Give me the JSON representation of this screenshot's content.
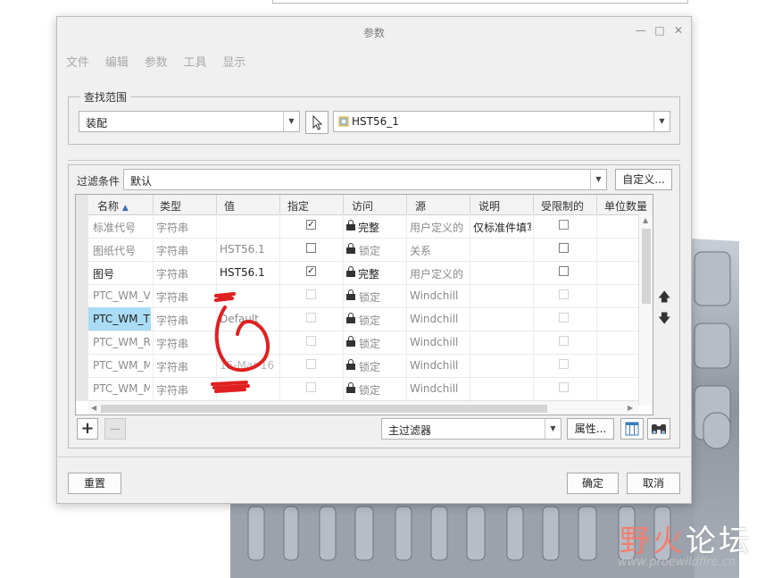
{
  "dialog": {
    "title": "参数",
    "window_controls": [
      "—",
      "□",
      "✕"
    ],
    "menu": [
      "文件",
      "编辑",
      "参数",
      "工具",
      "显示"
    ]
  },
  "search": {
    "legend": "查找范围",
    "scope_value": "装配",
    "model_value": "HST56_1"
  },
  "filter": {
    "label": "过滤条件",
    "value": "默认",
    "customize_label": "自定义..."
  },
  "table": {
    "columns": [
      "名称",
      "类型",
      "值",
      "指定",
      "访问",
      "源",
      "说明",
      "受限制的",
      "单位数量"
    ],
    "rows": [
      {
        "name": "标准代号",
        "type": "字符串",
        "value": "",
        "designate": true,
        "access": "完整",
        "source": "用户定义的",
        "desc": "仅标准件填写",
        "restricted": false
      },
      {
        "name": "图纸代号",
        "type": "字符串",
        "value": "HST56.1",
        "designate": false,
        "access": "锁定",
        "source": "关系",
        "desc": "",
        "restricted": false
      },
      {
        "name": "图号",
        "type": "字符串",
        "value": "HST56.1",
        "designate": true,
        "access": "完整",
        "source": "用户定义的",
        "desc": "",
        "restricted": false
      },
      {
        "name": "PTC_WM_V",
        "type": "字符串",
        "value": "",
        "designate": false,
        "access": "锁定",
        "source": "Windchill",
        "desc": "",
        "restricted": false
      },
      {
        "name": "PTC_WM_T",
        "type": "字符串",
        "value": "Default",
        "designate": false,
        "access": "锁定",
        "source": "Windchill",
        "desc": "",
        "restricted": false
      },
      {
        "name": "PTC_WM_R",
        "type": "字符串",
        "value": "",
        "designate": false,
        "access": "锁定",
        "source": "Windchill",
        "desc": "",
        "restricted": false
      },
      {
        "name": "PTC_WM_M",
        "type": "字符串",
        "value": "15-Mar-16",
        "designate": false,
        "access": "锁定",
        "source": "Windchill",
        "desc": "",
        "restricted": false
      },
      {
        "name": "PTC_WM_M",
        "type": "字符串",
        "value": "",
        "designate": false,
        "access": "锁定",
        "source": "Windchill",
        "desc": "",
        "restricted": false
      }
    ]
  },
  "bottom_bar": {
    "add_label": "+",
    "remove_label": "—",
    "filter_value": "主过滤器",
    "properties_label": "属性..."
  },
  "footer": {
    "reset_label": "重置",
    "ok_label": "确定",
    "cancel_label": "取消"
  },
  "watermark": {
    "title_part1": "野火",
    "title_part2": "论坛",
    "url": "www.proewildfire.cn"
  },
  "colors": {
    "selection": "#aadcf5",
    "watermark_red": "#f07f70",
    "scribble_red": "#e02020"
  }
}
